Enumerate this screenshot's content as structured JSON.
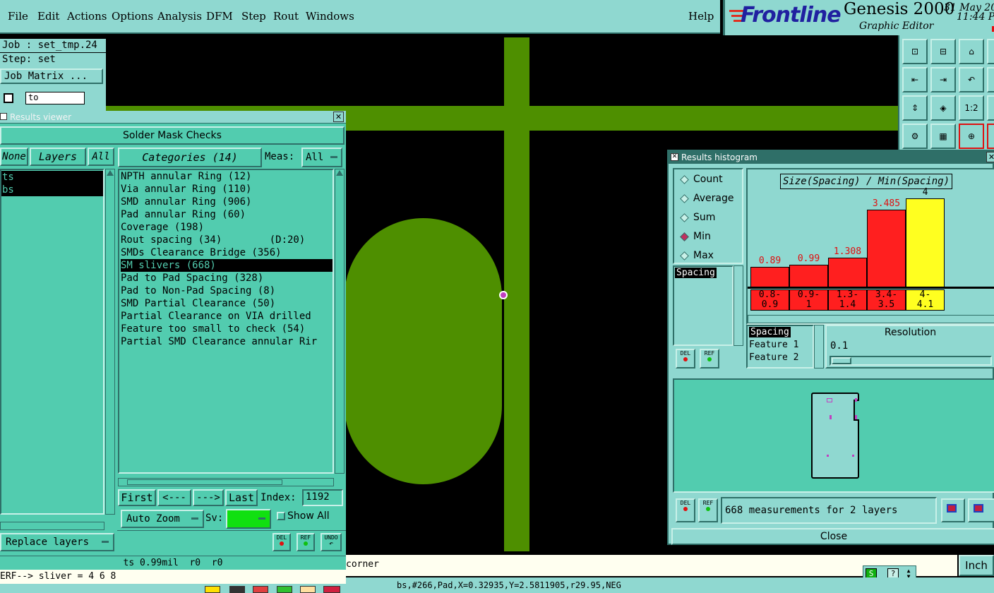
{
  "menubar": {
    "items": [
      "File",
      "Edit",
      "Actions",
      "Options",
      "Analysis",
      "DFM",
      "Step",
      "Rout",
      "Windows"
    ],
    "help": "Help"
  },
  "logo": {
    "brand": "Frontline",
    "product": "Genesis 2000",
    "subtitle": "Graphic Editor",
    "date": "31 May 20",
    "time": "11:44 P"
  },
  "job": {
    "job_line": "Job : set_tmp.24",
    "step_line": "Step: set",
    "matrix_button": "Job Matrix ...",
    "layer_field": "to"
  },
  "results_viewer": {
    "title": "Results viewer",
    "heading": "Solder Mask Checks",
    "none_btn": "None",
    "layers_btn": "Layers",
    "all_btn": "All",
    "layers": [
      "ts",
      "bs"
    ],
    "categories_btn": "Categories (14)",
    "meas_label": "Meas:",
    "meas_value": "All",
    "categories": [
      "NPTH annular Ring (12)",
      "Via annular Ring (110)",
      "SMD annular Ring (906)",
      "Pad annular Ring (60)",
      "Coverage (198)",
      "Rout spacing (34)        (D:20)",
      "SMDs Clearance Bridge (356)",
      "SM slivers (668)",
      "Pad to Pad Spacing (328)",
      "Pad to Non-Pad Spacing (8)",
      "SMD Partial Clearance (50)",
      "Partial Clearance on VIA drilled",
      "Feature too small to check (54)",
      "Partial SMD Clearance annular Rir"
    ],
    "selected_category": 7,
    "first_btn": "First",
    "prev_btn": "<---",
    "next_btn": "--->",
    "last_btn": "Last",
    "index_label": "Index:",
    "index_value": "1192",
    "auto_zoom": "Auto Zoom",
    "sv_label": "Sv:",
    "show_all": "Show All",
    "replace_layers": "Replace layers",
    "del_label": "DEL",
    "ref_label": "REF",
    "undo_label": "UNDO",
    "status_line": "ts 0.99mil  r0  r0",
    "message_line": "ERF--> sliver = 4 6 8"
  },
  "histogram": {
    "title": "Results histogram",
    "modes": [
      "Count",
      "Average",
      "Sum",
      "Min",
      "Max"
    ],
    "selected_mode": "Min",
    "list_item": "Spacing",
    "chart_title": "Size(Spacing) / Min(Spacing)",
    "fields": [
      "Spacing",
      "Feature 1",
      "Feature 2"
    ],
    "resolution_label": "Resolution",
    "resolution_value": "0.1",
    "summary": "668 measurements for 2 layers",
    "close_btn": "Close",
    "del_label": "DEL",
    "ref_label": "REF"
  },
  "chart_data": {
    "type": "bar",
    "title": "Size(Spacing) / Min(Spacing)",
    "categories": [
      "0.8-0.9",
      "0.9-1",
      "1.3-1.4",
      "3.4-3.5",
      "4-4.1"
    ],
    "range_top": [
      "0.8-",
      "0.9-",
      "1.3-",
      "3.4-",
      "4-"
    ],
    "range_bottom": [
      "0.9",
      "1",
      "1.4",
      "3.5",
      "4.1"
    ],
    "values": [
      0.89,
      0.99,
      1.308,
      3.485,
      4
    ],
    "value_labels": [
      "0.89",
      "0.99",
      "1.308",
      "3.485",
      "4"
    ],
    "ylim": [
      0,
      4.1
    ],
    "colors": [
      "#ff1f1f",
      "#ff1f1f",
      "#ff1f1f",
      "#ff1f1f",
      "#ffff20"
    ],
    "grid": false
  },
  "bottom": {
    "corner_text": "corner",
    "coord_text": "bs,#266,Pad,X=0.32935,Y=2.5811905,r29.95,NEG",
    "unit_btn": "Inch"
  },
  "colors": {
    "panel": "#52ccaf",
    "panel_light": "#8fd8d0",
    "board_green": "#4e8f00",
    "bar_red": "#ff1f1f",
    "bar_yellow": "#ffff20",
    "marker": "#c040c0"
  }
}
